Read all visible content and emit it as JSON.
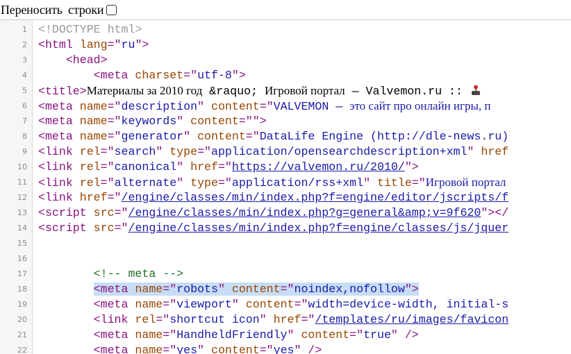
{
  "toolbar": {
    "wrap_label": "Переносить строки",
    "wrap_checked": false
  },
  "lines": [
    {
      "n": "1",
      "indent": "",
      "tokens": [
        {
          "t": "<!DOCTYPE html>",
          "c": "doctype"
        }
      ]
    },
    {
      "n": "2",
      "indent": "",
      "tokens": [
        {
          "t": "<html",
          "c": "tag"
        },
        {
          "t": " lang",
          "c": "attr"
        },
        {
          "t": "=\"",
          "c": "tag"
        },
        {
          "t": "ru",
          "c": "val"
        },
        {
          "t": "\">",
          "c": "tag"
        }
      ]
    },
    {
      "n": "3",
      "indent": "    ",
      "tokens": [
        {
          "t": "<head>",
          "c": "tag"
        }
      ]
    },
    {
      "n": "4",
      "indent": "        ",
      "tokens": [
        {
          "t": "<meta",
          "c": "tag"
        },
        {
          "t": " charset",
          "c": "attr"
        },
        {
          "t": "=\"",
          "c": "tag"
        },
        {
          "t": "utf-8",
          "c": "val"
        },
        {
          "t": "\">",
          "c": "tag"
        }
      ]
    },
    {
      "n": "5",
      "indent": "",
      "tokens": [
        {
          "t": "<title>",
          "c": "tag"
        },
        {
          "t": "Материалы за 2010 год",
          "c": "txt serif"
        },
        {
          "t": " &raquo; ",
          "c": "txt"
        },
        {
          "t": "Игровой портал",
          "c": "txt serif"
        },
        {
          "t": " — Valvemon.ru ::",
          "c": "txt"
        },
        {
          "t": " ",
          "c": "txt"
        },
        {
          "t": "",
          "c": "txt",
          "icon": "joystick-icon"
        }
      ]
    },
    {
      "n": "6",
      "indent": "",
      "tokens": [
        {
          "t": "<meta",
          "c": "tag"
        },
        {
          "t": " name",
          "c": "attr"
        },
        {
          "t": "=\"",
          "c": "tag"
        },
        {
          "t": "description",
          "c": "val"
        },
        {
          "t": "\"",
          "c": "tag"
        },
        {
          "t": " content",
          "c": "attr"
        },
        {
          "t": "=\"",
          "c": "tag"
        },
        {
          "t": "VALVEMON — ",
          "c": "val"
        },
        {
          "t": "это сайт про онлайн игры, п",
          "c": "val serif"
        }
      ]
    },
    {
      "n": "7",
      "indent": "",
      "tokens": [
        {
          "t": "<meta",
          "c": "tag"
        },
        {
          "t": " name",
          "c": "attr"
        },
        {
          "t": "=\"",
          "c": "tag"
        },
        {
          "t": "keywords",
          "c": "val"
        },
        {
          "t": "\"",
          "c": "tag"
        },
        {
          "t": " content",
          "c": "attr"
        },
        {
          "t": "=\"\">",
          "c": "tag"
        }
      ]
    },
    {
      "n": "8",
      "indent": "",
      "tokens": [
        {
          "t": "<meta",
          "c": "tag"
        },
        {
          "t": " name",
          "c": "attr"
        },
        {
          "t": "=\"",
          "c": "tag"
        },
        {
          "t": "generator",
          "c": "val"
        },
        {
          "t": "\"",
          "c": "tag"
        },
        {
          "t": " content",
          "c": "attr"
        },
        {
          "t": "=\"",
          "c": "tag"
        },
        {
          "t": "DataLife Engine (http://dle-news.ru)",
          "c": "val"
        }
      ]
    },
    {
      "n": "9",
      "indent": "",
      "tokens": [
        {
          "t": "<link",
          "c": "tag"
        },
        {
          "t": " rel",
          "c": "attr"
        },
        {
          "t": "=\"",
          "c": "tag"
        },
        {
          "t": "search",
          "c": "val"
        },
        {
          "t": "\"",
          "c": "tag"
        },
        {
          "t": " type",
          "c": "attr"
        },
        {
          "t": "=\"",
          "c": "tag"
        },
        {
          "t": "application/opensearchdescription+xml",
          "c": "val"
        },
        {
          "t": "\"",
          "c": "tag"
        },
        {
          "t": " href",
          "c": "attr"
        }
      ]
    },
    {
      "n": "10",
      "indent": "",
      "tokens": [
        {
          "t": "<link",
          "c": "tag"
        },
        {
          "t": " rel",
          "c": "attr"
        },
        {
          "t": "=\"",
          "c": "tag"
        },
        {
          "t": "canonical",
          "c": "val"
        },
        {
          "t": "\"",
          "c": "tag"
        },
        {
          "t": " href",
          "c": "attr"
        },
        {
          "t": "=\"",
          "c": "tag"
        },
        {
          "t": "https://valvemon.ru/2010/",
          "c": "lnk"
        },
        {
          "t": "\">",
          "c": "tag"
        }
      ]
    },
    {
      "n": "11",
      "indent": "",
      "tokens": [
        {
          "t": "<link",
          "c": "tag"
        },
        {
          "t": " rel",
          "c": "attr"
        },
        {
          "t": "=\"",
          "c": "tag"
        },
        {
          "t": "alternate",
          "c": "val"
        },
        {
          "t": "\"",
          "c": "tag"
        },
        {
          "t": " type",
          "c": "attr"
        },
        {
          "t": "=\"",
          "c": "tag"
        },
        {
          "t": "application/rss+xml",
          "c": "val"
        },
        {
          "t": "\"",
          "c": "tag"
        },
        {
          "t": " title",
          "c": "attr"
        },
        {
          "t": "=\"",
          "c": "tag"
        },
        {
          "t": "Игровой портал",
          "c": "val serif"
        }
      ]
    },
    {
      "n": "12",
      "indent": "",
      "tokens": [
        {
          "t": "<link",
          "c": "tag"
        },
        {
          "t": " href",
          "c": "attr"
        },
        {
          "t": "=\"",
          "c": "tag"
        },
        {
          "t": "/engine/classes/min/index.php?f=engine/editor/jscripts/f",
          "c": "lnk"
        }
      ]
    },
    {
      "n": "13",
      "indent": "",
      "tokens": [
        {
          "t": "<script",
          "c": "tag"
        },
        {
          "t": " src",
          "c": "attr"
        },
        {
          "t": "=\"",
          "c": "tag"
        },
        {
          "t": "/engine/classes/min/index.php?g=general&amp;v=9f620",
          "c": "lnk"
        },
        {
          "t": "\"></",
          "c": "tag"
        }
      ]
    },
    {
      "n": "14",
      "indent": "",
      "tokens": [
        {
          "t": "<script",
          "c": "tag"
        },
        {
          "t": " src",
          "c": "attr"
        },
        {
          "t": "=\"",
          "c": "tag"
        },
        {
          "t": "/engine/classes/min/index.php?f=engine/classes/js/jquer",
          "c": "lnk"
        }
      ]
    },
    {
      "n": "15",
      "indent": "",
      "tokens": []
    },
    {
      "n": "16",
      "indent": "",
      "tokens": []
    },
    {
      "n": "17",
      "indent": "        ",
      "tokens": [
        {
          "t": "<!-- meta -->",
          "c": "comment"
        }
      ]
    },
    {
      "n": "18",
      "indent": "        ",
      "highlight": true,
      "tokens": [
        {
          "t": "<meta",
          "c": "tag"
        },
        {
          "t": " name",
          "c": "attr"
        },
        {
          "t": "=\"",
          "c": "tag"
        },
        {
          "t": "robots",
          "c": "val"
        },
        {
          "t": "\"",
          "c": "tag"
        },
        {
          "t": " content",
          "c": "attr"
        },
        {
          "t": "=\"",
          "c": "tag"
        },
        {
          "t": "noindex,nofollow",
          "c": "val"
        },
        {
          "t": "\">",
          "c": "tag"
        }
      ]
    },
    {
      "n": "19",
      "indent": "        ",
      "tokens": [
        {
          "t": "<meta",
          "c": "tag"
        },
        {
          "t": " name",
          "c": "attr"
        },
        {
          "t": "=\"",
          "c": "tag"
        },
        {
          "t": "viewport",
          "c": "val"
        },
        {
          "t": "\"",
          "c": "tag"
        },
        {
          "t": " content",
          "c": "attr"
        },
        {
          "t": "=\"",
          "c": "tag"
        },
        {
          "t": "width=device-width, initial-s",
          "c": "val"
        }
      ]
    },
    {
      "n": "20",
      "indent": "        ",
      "tokens": [
        {
          "t": "<link",
          "c": "tag"
        },
        {
          "t": " rel",
          "c": "attr"
        },
        {
          "t": "=\"",
          "c": "tag"
        },
        {
          "t": "shortcut icon",
          "c": "val"
        },
        {
          "t": "\"",
          "c": "tag"
        },
        {
          "t": " href",
          "c": "attr"
        },
        {
          "t": "=\"",
          "c": "tag"
        },
        {
          "t": "/templates/ru/images/favicon",
          "c": "lnk"
        }
      ]
    },
    {
      "n": "21",
      "indent": "        ",
      "tokens": [
        {
          "t": "<meta",
          "c": "tag"
        },
        {
          "t": " name",
          "c": "attr"
        },
        {
          "t": "=\"",
          "c": "tag"
        },
        {
          "t": "HandheldFriendly",
          "c": "val"
        },
        {
          "t": "\"",
          "c": "tag"
        },
        {
          "t": " content",
          "c": "attr"
        },
        {
          "t": "=\"",
          "c": "tag"
        },
        {
          "t": "true",
          "c": "val"
        },
        {
          "t": "\" />",
          "c": "tag"
        }
      ]
    },
    {
      "n": "22",
      "indent": "        ",
      "tokens": [
        {
          "t": "<meta",
          "c": "tag"
        },
        {
          "t": " name",
          "c": "attr"
        },
        {
          "t": "=\"",
          "c": "tag"
        },
        {
          "t": "yes",
          "c": "val"
        },
        {
          "t": "\"",
          "c": "tag"
        },
        {
          "t": " content",
          "c": "attr"
        },
        {
          "t": "=\"",
          "c": "tag"
        },
        {
          "t": "yes",
          "c": "val"
        },
        {
          "t": "\" />",
          "c": "tag"
        }
      ]
    }
  ]
}
